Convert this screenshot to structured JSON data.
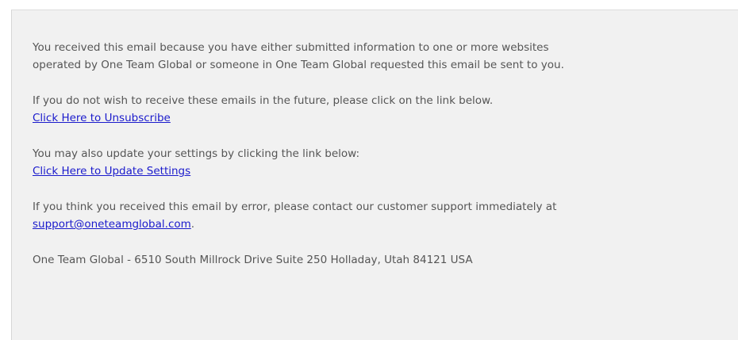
{
  "footer": {
    "intro_line1": "You received this email because you have either submitted information to one or more websites",
    "intro_line2": "operated by One Team Global or someone in One Team Global requested this email be sent to you.",
    "unsubscribe_text": "If you do not wish to receive these emails in the future, please click on the link below.",
    "unsubscribe_link": "Click Here to Unsubscribe",
    "settings_text": "You may also update your settings by clicking the link below:",
    "settings_link": "Click Here to Update Settings",
    "error_text": "If you think you received this email by error, please contact our customer support immediately at",
    "support_email": "support@oneteamglobal.com",
    "support_suffix": ".",
    "address": "One Team Global - 6510 South Millrock Drive Suite 250 Holladay, Utah 84121 USA"
  }
}
